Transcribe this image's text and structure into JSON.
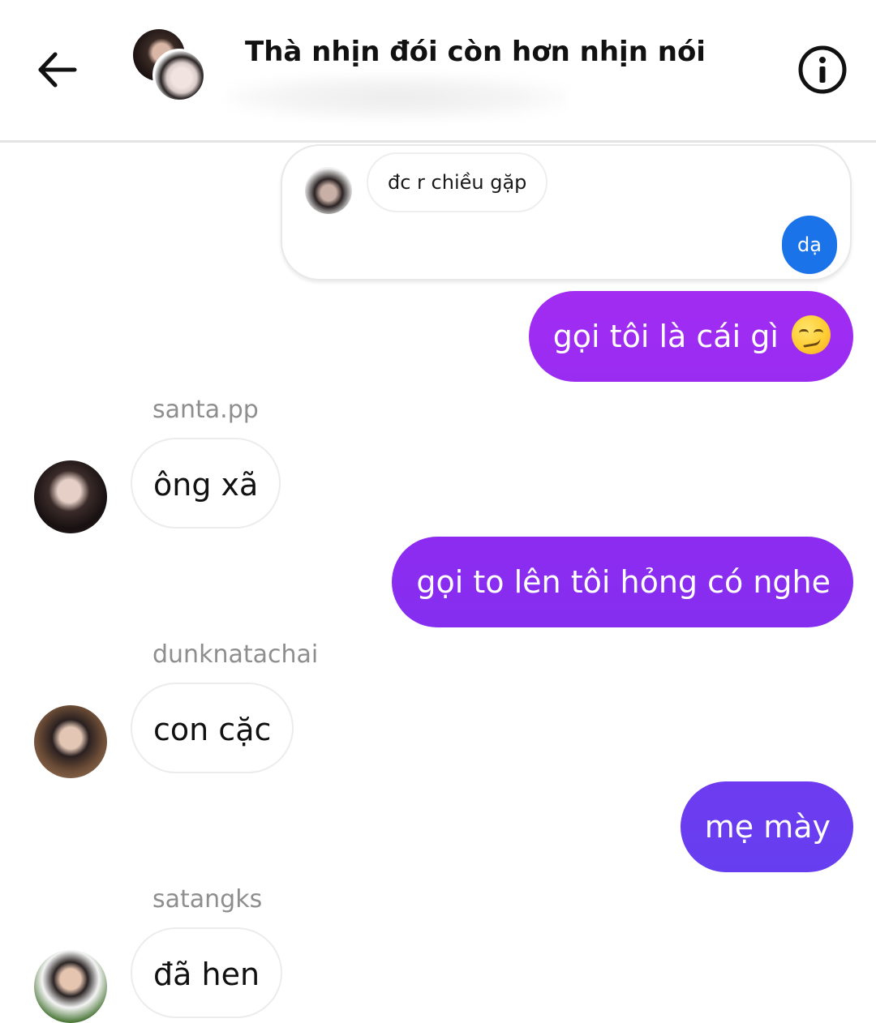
{
  "header": {
    "title": "Thà nhịn đói còn hơn nhịn nói",
    "back_icon": "arrow-left-icon",
    "info_icon": "info-circle-icon"
  },
  "quoted": {
    "original_text": "đc r chiều gặp",
    "reply_text": "dạ",
    "reply_color": "#1a73e8"
  },
  "messages": [
    {
      "type": "outgoing",
      "text": "gọi tôi là cái gì",
      "emoji": "smirking-face-emoji",
      "color": "#a12cf0"
    },
    {
      "type": "incoming",
      "sender": "santa.pp",
      "text": "ông xã"
    },
    {
      "type": "outgoing",
      "text": "gọi to lên tôi hỏng có nghe",
      "color": "#8a2cf0"
    },
    {
      "type": "incoming",
      "sender": "dunknatachai",
      "text": "con cặc"
    },
    {
      "type": "outgoing",
      "text": "mẹ mày",
      "color": "#6a3df0"
    },
    {
      "type": "incoming",
      "sender": "satangks",
      "text": "đã hen"
    }
  ],
  "colors": {
    "outgoing_top": "#a12cf0",
    "outgoing_bottom": "#6a3df0",
    "sender_name": "#8e8e8e"
  }
}
